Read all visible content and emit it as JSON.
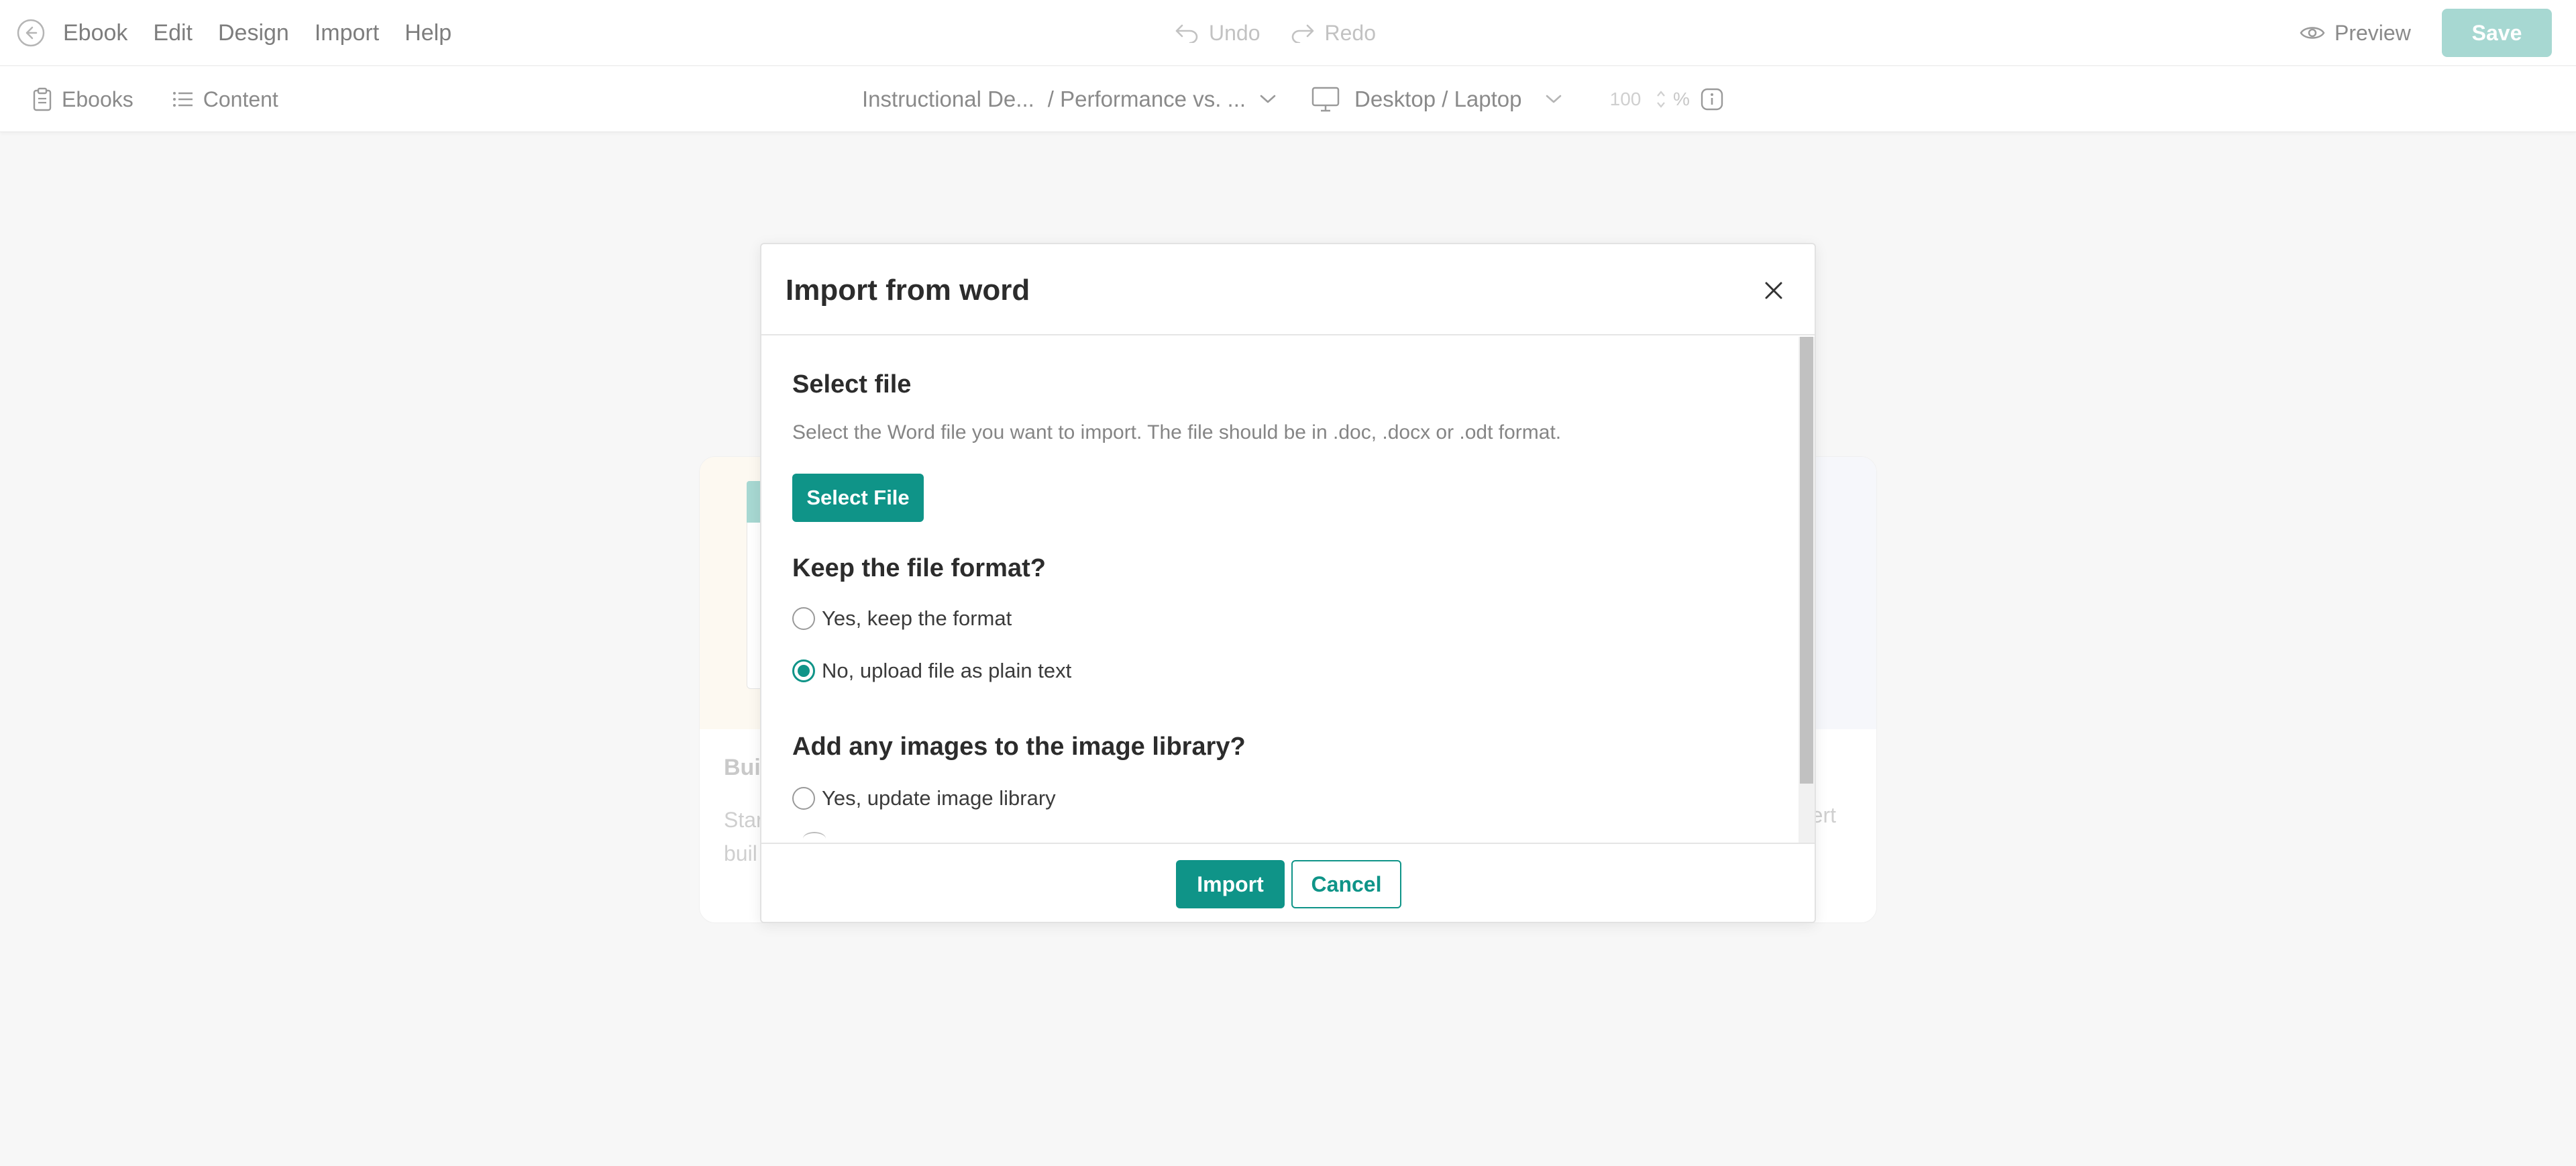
{
  "topbar": {
    "menu": [
      "Ebook",
      "Edit",
      "Design",
      "Import",
      "Help"
    ],
    "undo_label": "Undo",
    "redo_label": "Redo",
    "preview_label": "Preview",
    "save_label": "Save"
  },
  "toolbar": {
    "ebooks_label": "Ebooks",
    "content_label": "Content",
    "breadcrumb_book": "Instructional De...",
    "breadcrumb_page": "/ Performance vs. ...",
    "device_label": "Desktop / Laptop",
    "zoom_value": "100",
    "zoom_unit": "%"
  },
  "background_card": {
    "title_fragment": "Bui",
    "desc_line1": "Star",
    "desc_line2": "buil",
    "desc_right": "ert"
  },
  "modal": {
    "title": "Import from word",
    "select_file": {
      "heading": "Select file",
      "description": "Select the Word file you want to import. The file should be in .doc, .docx or .odt format.",
      "button_label": "Select File"
    },
    "keep_format": {
      "heading": "Keep the file format?",
      "options": [
        {
          "label": "Yes, keep the format",
          "checked": false
        },
        {
          "label": "No, upload file as plain text",
          "checked": true
        }
      ]
    },
    "images": {
      "heading": "Add any images to the image library?",
      "options": [
        {
          "label": "Yes, update image library",
          "checked": false
        }
      ]
    },
    "import_label": "Import",
    "cancel_label": "Cancel"
  },
  "colors": {
    "accent": "#0f9488",
    "accent_light": "#a7d8d2"
  }
}
